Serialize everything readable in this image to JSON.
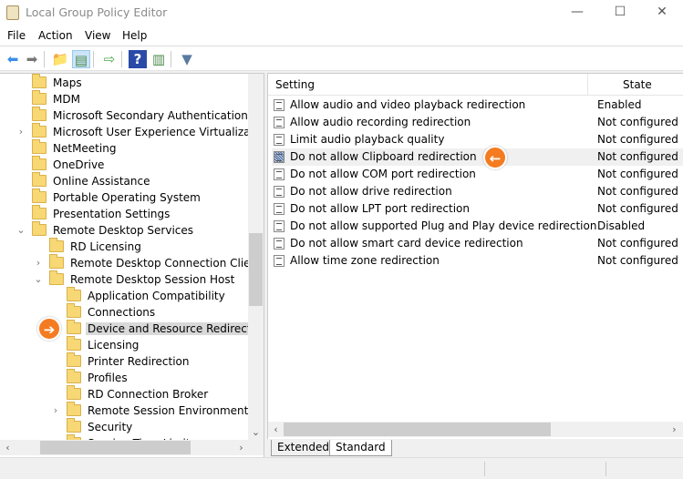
{
  "window": {
    "title": "Local Group Policy Editor",
    "minimize": "—",
    "maximize": "☐",
    "close": "✕"
  },
  "menu": [
    "File",
    "Action",
    "View",
    "Help"
  ],
  "toolbar": [
    {
      "icon": "back-arrow-icon",
      "glyph": "⬅",
      "color": "#3a8ee6"
    },
    {
      "icon": "forward-arrow-icon",
      "glyph": "➡",
      "color": "#777777"
    },
    {
      "icon": "up-folder-icon",
      "glyph": "📁",
      "color": "#d8a830"
    },
    {
      "icon": "show-hide-tree-icon",
      "glyph": "▤",
      "color": "#4a8a4a"
    },
    {
      "icon": "export-list-icon",
      "glyph": "⇨",
      "color": "#4aa84a"
    },
    {
      "icon": "help-icon",
      "glyph": "?",
      "color": "#2a4aa8"
    },
    {
      "icon": "show-action-pane-icon",
      "glyph": "▥",
      "color": "#4a8a4a"
    },
    {
      "icon": "filter-icon",
      "glyph": "▼",
      "color": "#5a7aa0"
    }
  ],
  "tree": [
    {
      "label": "Maps",
      "level": 0,
      "chevron": ""
    },
    {
      "label": "MDM",
      "level": 0,
      "chevron": ""
    },
    {
      "label": "Microsoft Secondary Authentication Fact",
      "level": 0,
      "chevron": ""
    },
    {
      "label": "Microsoft User Experience Virtualization",
      "level": 0,
      "chevron": "›"
    },
    {
      "label": "NetMeeting",
      "level": 0,
      "chevron": ""
    },
    {
      "label": "OneDrive",
      "level": 0,
      "chevron": ""
    },
    {
      "label": "Online Assistance",
      "level": 0,
      "chevron": ""
    },
    {
      "label": "Portable Operating System",
      "level": 0,
      "chevron": ""
    },
    {
      "label": "Presentation Settings",
      "level": 0,
      "chevron": ""
    },
    {
      "label": "Remote Desktop Services",
      "level": 0,
      "chevron": "⌄"
    },
    {
      "label": "RD Licensing",
      "level": 1,
      "chevron": ""
    },
    {
      "label": "Remote Desktop Connection Client",
      "level": 1,
      "chevron": "›"
    },
    {
      "label": "Remote Desktop Session Host",
      "level": 1,
      "chevron": "⌄"
    },
    {
      "label": "Application Compatibility",
      "level": 2,
      "chevron": ""
    },
    {
      "label": "Connections",
      "level": 2,
      "chevron": ""
    },
    {
      "label": "Device and Resource Redirection",
      "level": 2,
      "chevron": "",
      "selected": true
    },
    {
      "label": "Licensing",
      "level": 2,
      "chevron": ""
    },
    {
      "label": "Printer Redirection",
      "level": 2,
      "chevron": ""
    },
    {
      "label": "Profiles",
      "level": 2,
      "chevron": ""
    },
    {
      "label": "RD Connection Broker",
      "level": 2,
      "chevron": ""
    },
    {
      "label": "Remote Session Environment",
      "level": 2,
      "chevron": "›"
    },
    {
      "label": "Security",
      "level": 2,
      "chevron": ""
    },
    {
      "label": "Session Time Limits",
      "level": 2,
      "chevron": ""
    }
  ],
  "list": {
    "headers": {
      "setting": "Setting",
      "state": "State"
    },
    "rows": [
      {
        "setting": "Allow audio and video playback redirection",
        "state": "Enabled"
      },
      {
        "setting": "Allow audio recording redirection",
        "state": "Not configured"
      },
      {
        "setting": "Limit audio playback quality",
        "state": "Not configured"
      },
      {
        "setting": "Do not allow Clipboard redirection",
        "state": "Not configured",
        "selected": true
      },
      {
        "setting": "Do not allow COM port redirection",
        "state": "Not configured"
      },
      {
        "setting": "Do not allow drive redirection",
        "state": "Not configured"
      },
      {
        "setting": "Do not allow LPT port redirection",
        "state": "Not configured"
      },
      {
        "setting": "Do not allow supported Plug and Play device redirection",
        "state": "Disabled"
      },
      {
        "setting": "Do not allow smart card device redirection",
        "state": "Not configured"
      },
      {
        "setting": "Allow time zone redirection",
        "state": "Not configured"
      }
    ]
  },
  "tabs": {
    "extended": "Extended",
    "standard": "Standard",
    "active": "Standard"
  },
  "callouts": {
    "tree_arrow": "➔",
    "list_arrow": "←",
    "color": "#f47b20"
  }
}
